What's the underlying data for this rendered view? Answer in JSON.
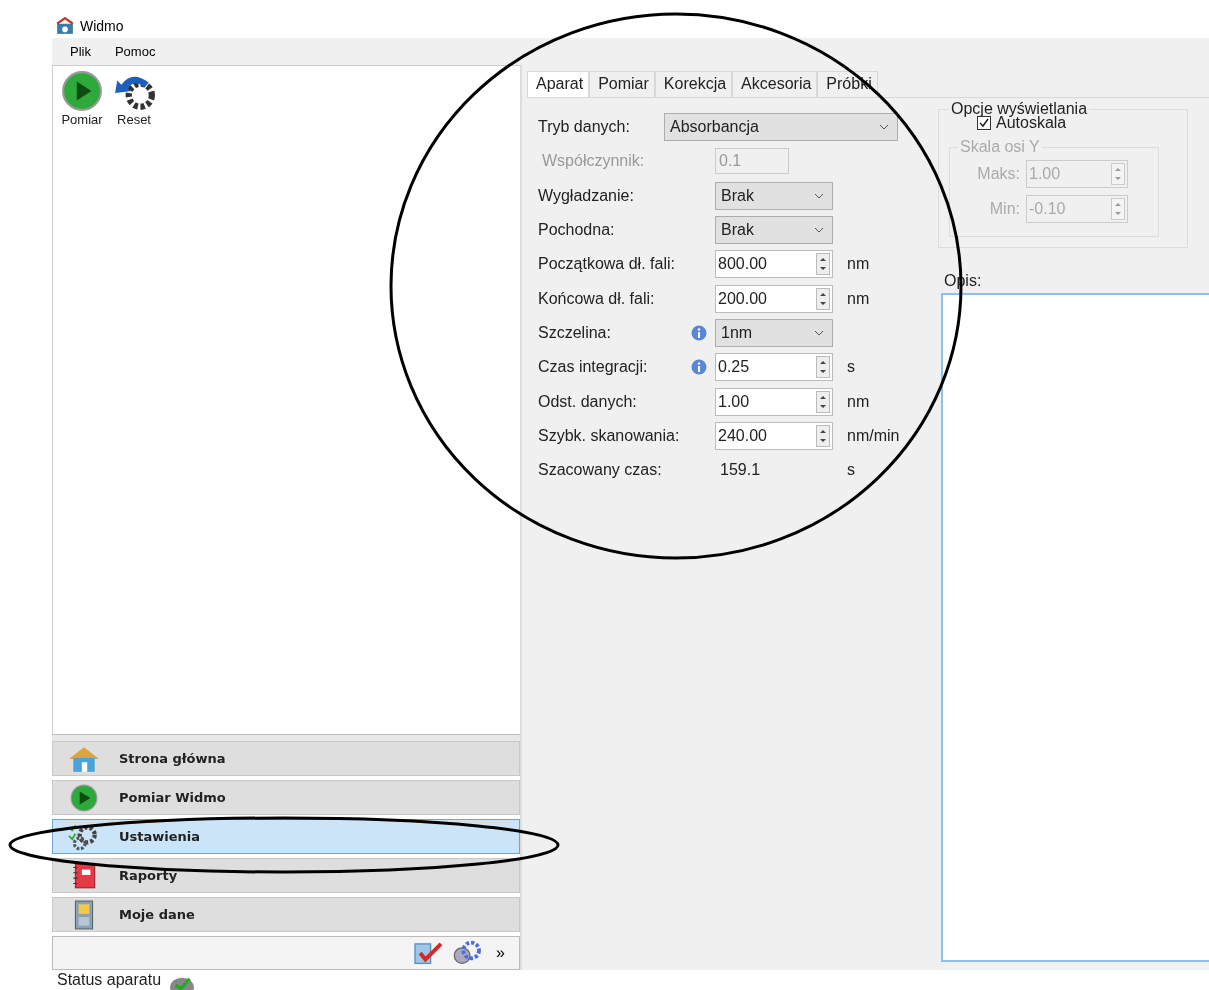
{
  "window": {
    "title": "Widmo"
  },
  "menu": [
    "Plik",
    "Pomoc"
  ],
  "toolbar": [
    {
      "label": "Pomiar"
    },
    {
      "label": "Reset"
    }
  ],
  "nav": [
    {
      "label": "Strona główna",
      "selected": false
    },
    {
      "label": "Pomiar Widmo",
      "selected": false
    },
    {
      "label": "Ustawienia",
      "selected": true
    },
    {
      "label": "Raporty",
      "selected": false
    },
    {
      "label": "Moje dane",
      "selected": false
    }
  ],
  "nav_footer": {
    "chevron": "»"
  },
  "tabs": [
    {
      "label": "Aparat",
      "selected": true
    },
    {
      "label": "Pomiar",
      "selected": false
    },
    {
      "label": "Korekcja",
      "selected": false
    },
    {
      "label": "Akcesoria",
      "selected": false
    },
    {
      "label": "Próbki",
      "selected": false
    }
  ],
  "form": [
    {
      "kind": "wide-select",
      "label": "Tryb danych:",
      "value": "Absorbancja"
    },
    {
      "kind": "text",
      "label": "Współczynnik:",
      "value": "0.1",
      "disabled": true
    },
    {
      "kind": "select",
      "label": "Wygładzanie:",
      "value": "Brak"
    },
    {
      "kind": "select",
      "label": "Pochodna:",
      "value": "Brak"
    },
    {
      "kind": "spin",
      "label": "Początkowa dł. fali:",
      "value": "800.00",
      "unit": "nm"
    },
    {
      "kind": "spin",
      "label": "Końcowa dł. fali:",
      "value": "200.00",
      "unit": "nm"
    },
    {
      "kind": "select",
      "label": "Szczelina:",
      "value": "1nm",
      "info": true
    },
    {
      "kind": "spin",
      "label": "Czas integracji:",
      "value": "0.25",
      "unit": "s",
      "info": true
    },
    {
      "kind": "spin",
      "label": "Odst. danych:",
      "value": "1.00",
      "unit": "nm"
    },
    {
      "kind": "spin",
      "label": "Szybk. skanowania:",
      "value": "240.00",
      "unit": "nm/min"
    },
    {
      "kind": "static",
      "label": "Szacowany czas:",
      "value": "159.1",
      "unit": "s"
    }
  ],
  "display_options": {
    "title": "Opcje wyświetlania",
    "autoscale": {
      "label": "Autoskala",
      "checked": true
    },
    "y_axis": {
      "title": "Skala osi Y",
      "disabled": true,
      "fields": [
        {
          "label": "Maks:",
          "value": "1.00"
        },
        {
          "label": "Min:",
          "value": "-0.10"
        }
      ]
    }
  },
  "description": {
    "label": "Opis:"
  },
  "status_bar": {
    "text": "Status aparatu"
  }
}
